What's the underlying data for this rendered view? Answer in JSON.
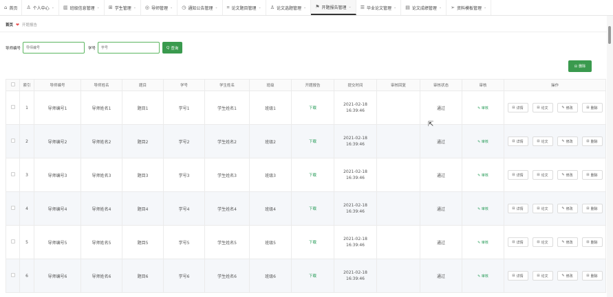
{
  "nav": {
    "items": [
      {
        "label": "首页",
        "icon": "home-icon",
        "glyph": "⌂",
        "active": false,
        "has_caret": false
      },
      {
        "label": "个人中心",
        "icon": "user-icon",
        "glyph": "♙",
        "active": false,
        "has_caret": true
      },
      {
        "label": "班级信息管理",
        "icon": "chart-icon",
        "glyph": "▥",
        "active": false,
        "has_caret": true
      },
      {
        "label": "学生管理",
        "icon": "grid-icon",
        "glyph": "⊞",
        "active": false,
        "has_caret": true
      },
      {
        "label": "导师管理",
        "icon": "circle-icon",
        "glyph": "◎",
        "active": false,
        "has_caret": true
      },
      {
        "label": "通知公告管理",
        "icon": "clock-icon",
        "glyph": "◷",
        "active": false,
        "has_caret": true
      },
      {
        "label": "论文题目管理",
        "icon": "frame-icon",
        "glyph": "⌗",
        "active": false,
        "has_caret": true
      },
      {
        "label": "论文选题管理",
        "icon": "person-icon",
        "glyph": "♙",
        "active": false,
        "has_caret": true
      },
      {
        "label": "开题报告管理",
        "icon": "flag-icon",
        "glyph": "⚑",
        "active": true,
        "has_caret": true
      },
      {
        "label": "毕业论文管理",
        "icon": "list-icon",
        "glyph": "☰",
        "active": false,
        "has_caret": true
      },
      {
        "label": "论文成绩管理",
        "icon": "bar-icon",
        "glyph": "▤",
        "active": false,
        "has_caret": true
      },
      {
        "label": "资料模板管理",
        "icon": "send-icon",
        "glyph": "➢",
        "active": false,
        "has_caret": true
      }
    ],
    "caret": "⌄"
  },
  "breadcrumb": {
    "home": "首页",
    "separator": "❤",
    "current": "开题报告"
  },
  "search": {
    "tutor_label": "导师编号",
    "tutor_placeholder": "导师编号",
    "student_label": "学号",
    "student_placeholder": "学号",
    "query_label": "查询",
    "query_icon": "Q"
  },
  "delete_top": {
    "label": "删除",
    "icon": "⊟"
  },
  "table": {
    "headers": [
      "",
      "索引",
      "导师编号",
      "导师姓名",
      "题目",
      "学号",
      "学生姓名",
      "班级",
      "开题报告",
      "提交时间",
      "审核回复",
      "审核状态",
      "审核",
      "操作"
    ],
    "rows": [
      {
        "index": "1",
        "tutor_no": "导师编号1",
        "tutor_name": "导师姓名1",
        "title": "题目1",
        "student_no": "学号1",
        "student_name": "学生姓名1",
        "class": "班级1",
        "report": "下载",
        "time": "2021-02-18 16:39:46",
        "reply": "",
        "status": "通过",
        "audit": "审核"
      },
      {
        "index": "2",
        "tutor_no": "导师编号2",
        "tutor_name": "导师姓名2",
        "title": "题目2",
        "student_no": "学号2",
        "student_name": "学生姓名2",
        "class": "班级2",
        "report": "下载",
        "time": "2021-02-18 16:39:46",
        "reply": "",
        "status": "通过",
        "audit": "审核"
      },
      {
        "index": "3",
        "tutor_no": "导师编号3",
        "tutor_name": "导师姓名3",
        "title": "题目3",
        "student_no": "学号3",
        "student_name": "学生姓名3",
        "class": "班级3",
        "report": "下载",
        "time": "2021-02-18 16:39:46",
        "reply": "",
        "status": "通过",
        "audit": "审核"
      },
      {
        "index": "4",
        "tutor_no": "导师编号4",
        "tutor_name": "导师姓名4",
        "title": "题目4",
        "student_no": "学号4",
        "student_name": "学生姓名4",
        "class": "班级4",
        "report": "下载",
        "time": "2021-02-18 16:39:46",
        "reply": "",
        "status": "通过",
        "audit": "审核"
      },
      {
        "index": "5",
        "tutor_no": "导师编号5",
        "tutor_name": "导师姓名5",
        "title": "题目5",
        "student_no": "学号5",
        "student_name": "学生姓名5",
        "class": "班级5",
        "report": "下载",
        "time": "2021-02-18 16:39:46",
        "reply": "",
        "status": "通过",
        "audit": "审核"
      },
      {
        "index": "6",
        "tutor_no": "导师编号6",
        "tutor_name": "导师姓名6",
        "title": "题目6",
        "student_no": "学号6",
        "student_name": "学生姓名6",
        "class": "班级6",
        "report": "下载",
        "time": "2021-02-18 16:39:46",
        "reply": "",
        "status": "通过",
        "audit": "审核"
      }
    ],
    "ops": {
      "detail": "详情",
      "detail_icon": "⊟",
      "paper": "论文",
      "paper_icon": "⊟",
      "edit": "修改",
      "edit_icon": "✎",
      "delete": "删除",
      "delete_icon": "⊟"
    },
    "audit_icon": "✎"
  },
  "colors": {
    "primary": "#3a9a4e",
    "link": "#2a9d5a",
    "heart": "#e94e4e"
  }
}
